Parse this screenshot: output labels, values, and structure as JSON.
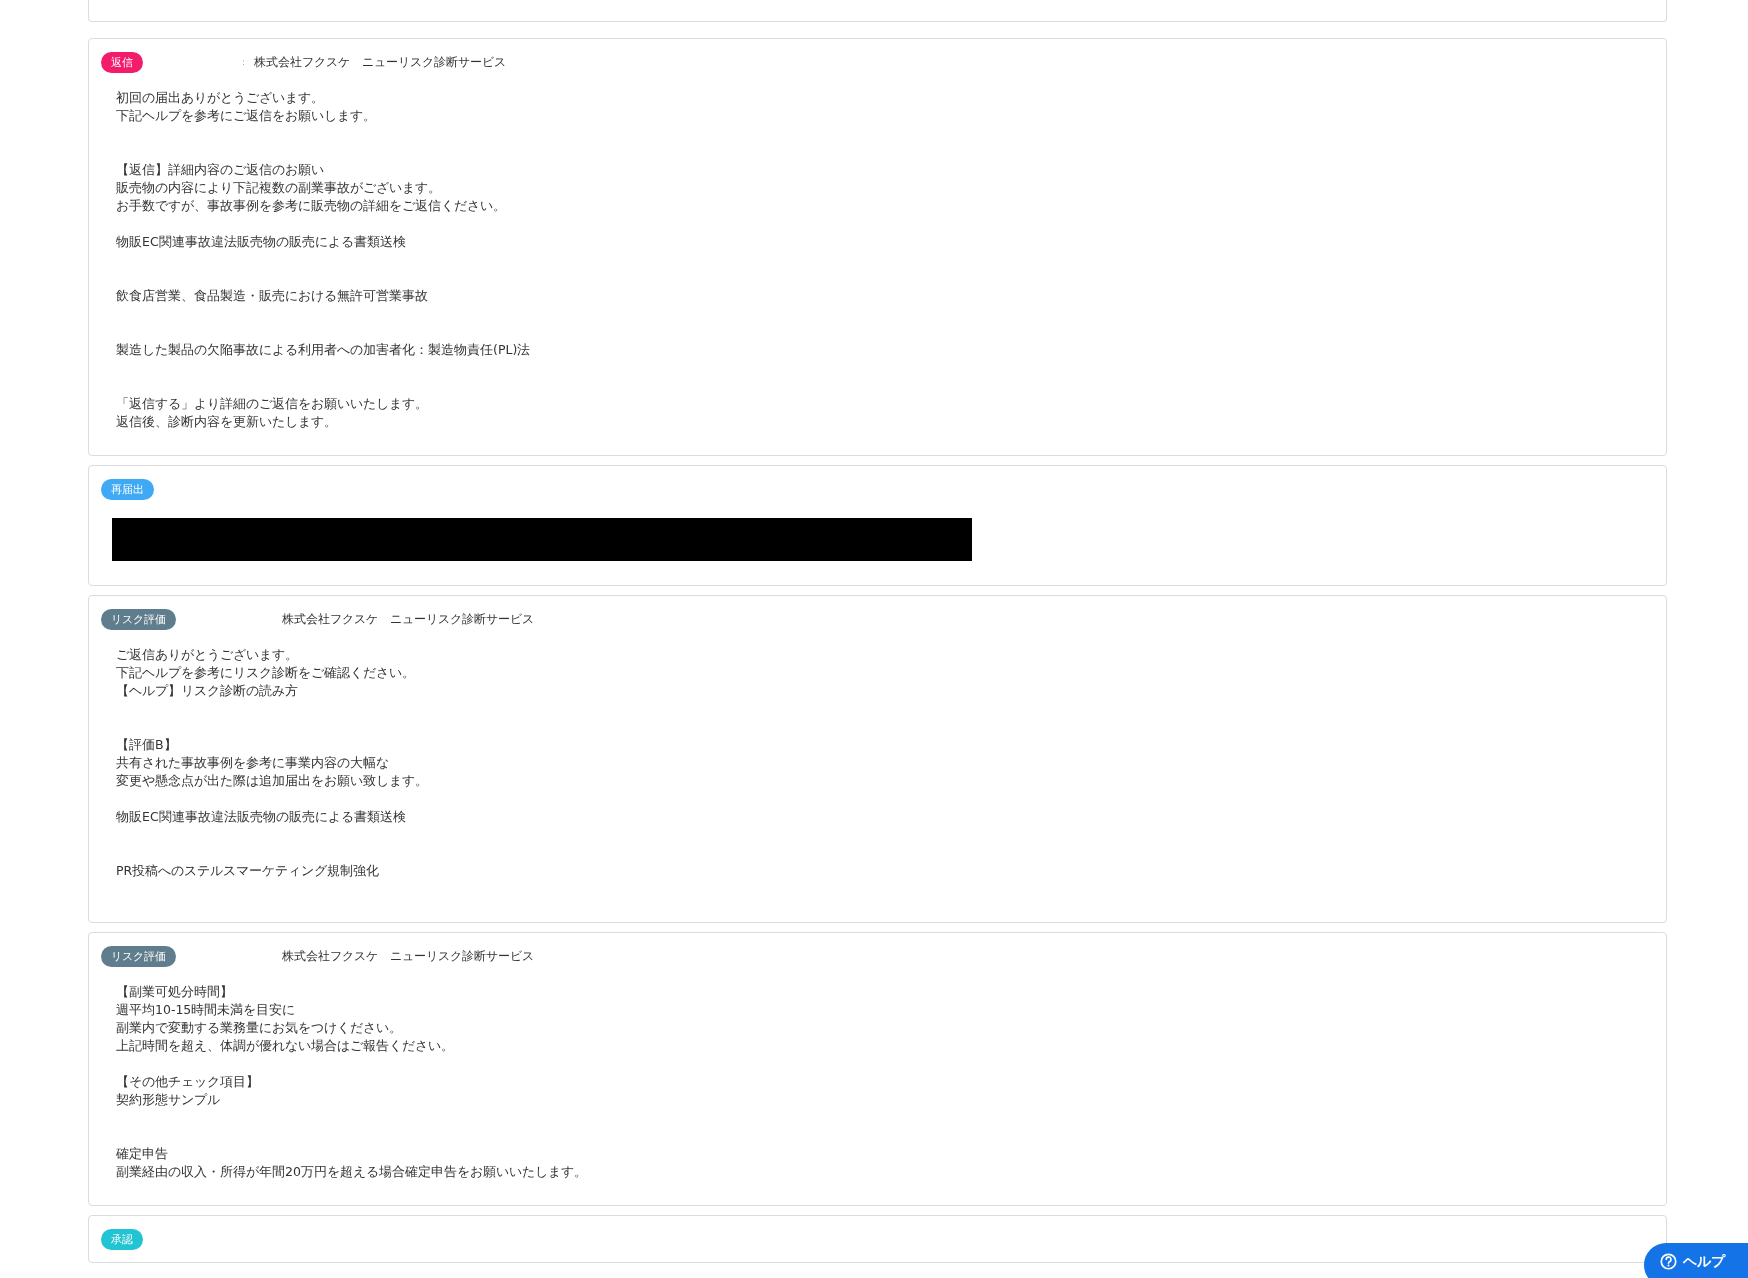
{
  "messages": [
    {
      "partial": true
    },
    {
      "badge": {
        "label": "返信",
        "color": "#f21c6b"
      },
      "separator": "：",
      "sender": "株式会社フクスケ　ニューリスク診断サービス",
      "lines": [
        {
          "kind": "text",
          "text": "初回の届出ありがとうございます。"
        },
        {
          "kind": "text",
          "text": "下記ヘルプを参考にご返信をお願いします。"
        },
        {
          "kind": "blank"
        },
        {
          "kind": "blank"
        },
        {
          "kind": "text",
          "text": "【返信】詳細内容のご返信のお願い"
        },
        {
          "kind": "text",
          "text": "販売物の内容により下記複数の副業事故がございます。"
        },
        {
          "kind": "text",
          "text": "お手数ですが、事故事例を参考に販売物の詳細をご返信ください。"
        },
        {
          "kind": "blank"
        },
        {
          "kind": "text",
          "text": "物販EC関連事故違法販売物の販売による書類送検"
        },
        {
          "kind": "blank"
        },
        {
          "kind": "blank"
        },
        {
          "kind": "text",
          "text": "飲食店営業、食品製造・販売における無許可営業事故"
        },
        {
          "kind": "blank"
        },
        {
          "kind": "blank"
        },
        {
          "kind": "text",
          "text": "製造した製品の欠陥事故による利用者への加害者化：製造物責任(PL)法"
        },
        {
          "kind": "blank"
        },
        {
          "kind": "blank"
        },
        {
          "kind": "text",
          "text": "「返信する」より詳細のご返信をお願いいたします。"
        },
        {
          "kind": "text",
          "text": "返信後、診断内容を更新いたします。"
        }
      ]
    },
    {
      "badge": {
        "label": "再届出",
        "color": "#3fa9f5"
      },
      "redacted": true
    },
    {
      "badge": {
        "label": "リスク評価",
        "color": "#5f7d8c"
      },
      "sender": "株式会社フクスケ　ニューリスク診断サービス",
      "lines": [
        {
          "kind": "text",
          "text": "ご返信ありがとうございます。"
        },
        {
          "kind": "text",
          "text": "下記ヘルプを参考にリスク診断をご確認ください。"
        },
        {
          "kind": "text",
          "text": "【ヘルプ】リスク診断の読み方"
        },
        {
          "kind": "blank"
        },
        {
          "kind": "blank"
        },
        {
          "kind": "text",
          "text": "【評価B】"
        },
        {
          "kind": "text",
          "text": "共有された事故事例を参考に事業内容の大幅な"
        },
        {
          "kind": "text",
          "text": "変更や懸念点が出た際は追加届出をお願い致します。"
        },
        {
          "kind": "blank"
        },
        {
          "kind": "text",
          "text": "物販EC関連事故違法販売物の販売による書類送検"
        },
        {
          "kind": "blank"
        },
        {
          "kind": "blank"
        },
        {
          "kind": "text",
          "text": "PR投稿へのステルスマーケティング規制強化"
        },
        {
          "kind": "blank"
        }
      ]
    },
    {
      "badge": {
        "label": "リスク評価",
        "color": "#5f7d8c"
      },
      "sender": "株式会社フクスケ　ニューリスク診断サービス",
      "lines": [
        {
          "kind": "text",
          "text": "【副業可処分時間】"
        },
        {
          "kind": "text",
          "text": "週平均10-15時間未満を目安に"
        },
        {
          "kind": "text",
          "text": "副業内で変動する業務量にお気をつけください。"
        },
        {
          "kind": "text",
          "text": "上記時間を超え、体調が優れない場合はご報告ください。"
        },
        {
          "kind": "blank"
        },
        {
          "kind": "text",
          "text": "【その他チェック項目】"
        },
        {
          "kind": "text",
          "text": "契約形態サンプル"
        },
        {
          "kind": "blank"
        },
        {
          "kind": "blank"
        },
        {
          "kind": "text",
          "text": "確定申告"
        },
        {
          "kind": "text",
          "text": "副業経由の収入・所得が年間20万円を超える場合確定申告をお願いいたします。"
        }
      ]
    },
    {
      "badge": {
        "label": "承認",
        "color": "#22c3d3"
      }
    }
  ],
  "help_button": {
    "label": "ヘルプ"
  }
}
